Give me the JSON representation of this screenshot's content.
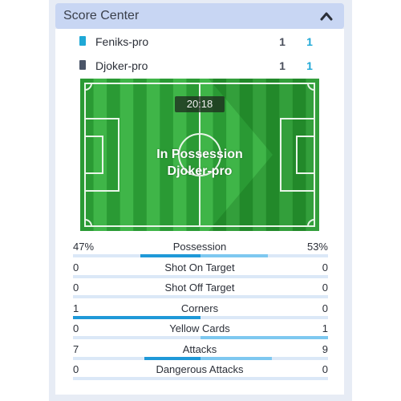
{
  "header": {
    "title": "Score Center",
    "collapse_icon": "chevron-up-icon"
  },
  "teams": [
    {
      "name": "Feniks-pro",
      "score_a": "1",
      "score_b": "1",
      "flag_color": "#1fa8d6"
    },
    {
      "name": "Djoker-pro",
      "score_a": "1",
      "score_b": "1",
      "flag_color": "#4a5568"
    }
  ],
  "pitch": {
    "clock": "20:18",
    "status_line1": "In Possession",
    "status_line2": "Djoker-pro",
    "grass_dark": "#2a9a34",
    "grass_light": "#3fb548"
  },
  "stats": [
    {
      "label": "Possession",
      "left": "47%",
      "right": "53%",
      "left_value": 47,
      "right_value": 53
    },
    {
      "label": "Shot On Target",
      "left": "0",
      "right": "0",
      "left_value": 0,
      "right_value": 0
    },
    {
      "label": "Shot Off Target",
      "left": "0",
      "right": "0",
      "left_value": 0,
      "right_value": 0
    },
    {
      "label": "Corners",
      "left": "1",
      "right": "0",
      "left_value": 1,
      "right_value": 0
    },
    {
      "label": "Yellow Cards",
      "left": "0",
      "right": "1",
      "left_value": 0,
      "right_value": 1
    },
    {
      "label": "Attacks",
      "left": "7",
      "right": "9",
      "left_value": 7,
      "right_value": 9
    },
    {
      "label": "Dangerous Attacks",
      "left": "0",
      "right": "0",
      "left_value": 0,
      "right_value": 0
    }
  ],
  "colors": {
    "accent_left": "#1f99d8",
    "accent_right": "#7ec8f0",
    "header_bg": "#c8d6f3"
  }
}
